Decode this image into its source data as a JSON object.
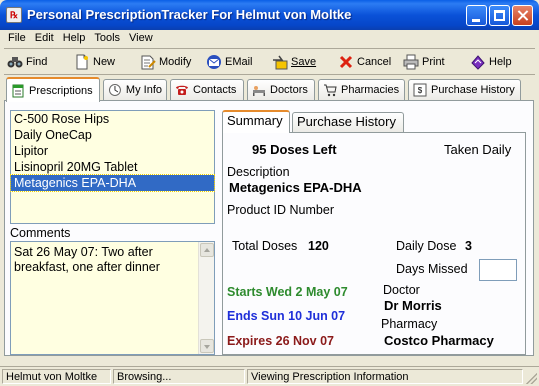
{
  "window": {
    "title": "Personal PrescriptionTracker For Helmut von Moltke",
    "app_icon": "prescription-app-icon"
  },
  "menu": [
    "File",
    "Edit",
    "Help",
    "Tools",
    "View"
  ],
  "toolbar": {
    "find": "Find",
    "new": "New",
    "modify": "Modify",
    "email": "EMail",
    "save": "Save",
    "cancel": "Cancel",
    "print": "Print",
    "help": "Help"
  },
  "tabs": [
    "Prescriptions",
    "My Info",
    "Contacts",
    "Doctors",
    "Pharmacies",
    "Purchase History"
  ],
  "prescriptions": [
    "C-500 Rose Hips",
    "Daily OneCap",
    "Lipitor",
    "Lisinopril 20MG Tablet",
    "Metagenics EPA-DHA"
  ],
  "selected_index": 4,
  "comments": {
    "label": "Comments",
    "text": "Sat 26 May 07: Two after breakfast, one after dinner"
  },
  "detail_tabs": [
    "Summary",
    "Purchase History"
  ],
  "summary": {
    "doses_left": "95 Doses Left",
    "frequency": "Taken Daily",
    "description_label": "Description",
    "description": "Metagenics EPA-DHA",
    "product_id_label": "Product ID Number",
    "total_doses_label": "Total Doses",
    "total_doses": "120",
    "daily_dose_label": "Daily Dose",
    "daily_dose": "3",
    "days_missed_label": "Days Missed",
    "starts": "Starts Wed 2 May 07",
    "ends": "Ends Sun 10 Jun 07",
    "expires": "Expires 26 Nov 07",
    "doctor_label": "Doctor",
    "doctor": "Dr Morris",
    "pharmacy_label": "Pharmacy",
    "pharmacy": "Costco Pharmacy"
  },
  "colors": {
    "starts": "#2E8B2E",
    "ends": "#1F2FD9",
    "expires": "#8B1A1A",
    "selection": "#316AC5",
    "list_bg": "#FFFFE1"
  },
  "status": {
    "user": "Helmut von Moltke",
    "mode": "Browsing...",
    "message": "Viewing Prescription Information"
  }
}
